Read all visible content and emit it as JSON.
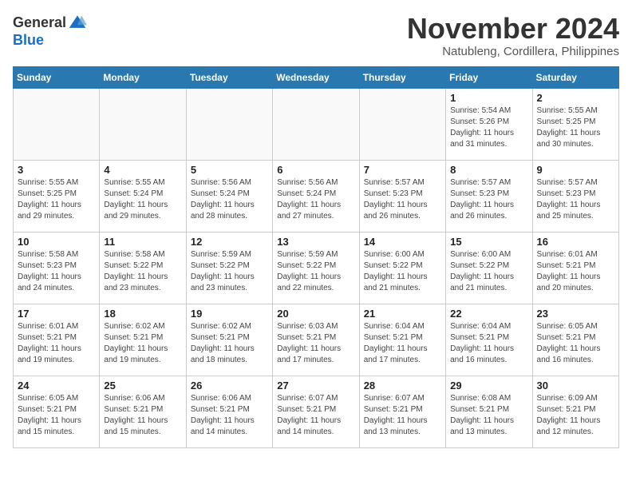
{
  "header": {
    "logo_general": "General",
    "logo_blue": "Blue",
    "month": "November 2024",
    "location": "Natubleng, Cordillera, Philippines"
  },
  "weekdays": [
    "Sunday",
    "Monday",
    "Tuesday",
    "Wednesday",
    "Thursday",
    "Friday",
    "Saturday"
  ],
  "weeks": [
    [
      {
        "day": "",
        "info": ""
      },
      {
        "day": "",
        "info": ""
      },
      {
        "day": "",
        "info": ""
      },
      {
        "day": "",
        "info": ""
      },
      {
        "day": "",
        "info": ""
      },
      {
        "day": "1",
        "info": "Sunrise: 5:54 AM\nSunset: 5:26 PM\nDaylight: 11 hours and 31 minutes."
      },
      {
        "day": "2",
        "info": "Sunrise: 5:55 AM\nSunset: 5:25 PM\nDaylight: 11 hours and 30 minutes."
      }
    ],
    [
      {
        "day": "3",
        "info": "Sunrise: 5:55 AM\nSunset: 5:25 PM\nDaylight: 11 hours and 29 minutes."
      },
      {
        "day": "4",
        "info": "Sunrise: 5:55 AM\nSunset: 5:24 PM\nDaylight: 11 hours and 29 minutes."
      },
      {
        "day": "5",
        "info": "Sunrise: 5:56 AM\nSunset: 5:24 PM\nDaylight: 11 hours and 28 minutes."
      },
      {
        "day": "6",
        "info": "Sunrise: 5:56 AM\nSunset: 5:24 PM\nDaylight: 11 hours and 27 minutes."
      },
      {
        "day": "7",
        "info": "Sunrise: 5:57 AM\nSunset: 5:23 PM\nDaylight: 11 hours and 26 minutes."
      },
      {
        "day": "8",
        "info": "Sunrise: 5:57 AM\nSunset: 5:23 PM\nDaylight: 11 hours and 26 minutes."
      },
      {
        "day": "9",
        "info": "Sunrise: 5:57 AM\nSunset: 5:23 PM\nDaylight: 11 hours and 25 minutes."
      }
    ],
    [
      {
        "day": "10",
        "info": "Sunrise: 5:58 AM\nSunset: 5:23 PM\nDaylight: 11 hours and 24 minutes."
      },
      {
        "day": "11",
        "info": "Sunrise: 5:58 AM\nSunset: 5:22 PM\nDaylight: 11 hours and 23 minutes."
      },
      {
        "day": "12",
        "info": "Sunrise: 5:59 AM\nSunset: 5:22 PM\nDaylight: 11 hours and 23 minutes."
      },
      {
        "day": "13",
        "info": "Sunrise: 5:59 AM\nSunset: 5:22 PM\nDaylight: 11 hours and 22 minutes."
      },
      {
        "day": "14",
        "info": "Sunrise: 6:00 AM\nSunset: 5:22 PM\nDaylight: 11 hours and 21 minutes."
      },
      {
        "day": "15",
        "info": "Sunrise: 6:00 AM\nSunset: 5:22 PM\nDaylight: 11 hours and 21 minutes."
      },
      {
        "day": "16",
        "info": "Sunrise: 6:01 AM\nSunset: 5:21 PM\nDaylight: 11 hours and 20 minutes."
      }
    ],
    [
      {
        "day": "17",
        "info": "Sunrise: 6:01 AM\nSunset: 5:21 PM\nDaylight: 11 hours and 19 minutes."
      },
      {
        "day": "18",
        "info": "Sunrise: 6:02 AM\nSunset: 5:21 PM\nDaylight: 11 hours and 19 minutes."
      },
      {
        "day": "19",
        "info": "Sunrise: 6:02 AM\nSunset: 5:21 PM\nDaylight: 11 hours and 18 minutes."
      },
      {
        "day": "20",
        "info": "Sunrise: 6:03 AM\nSunset: 5:21 PM\nDaylight: 11 hours and 17 minutes."
      },
      {
        "day": "21",
        "info": "Sunrise: 6:04 AM\nSunset: 5:21 PM\nDaylight: 11 hours and 17 minutes."
      },
      {
        "day": "22",
        "info": "Sunrise: 6:04 AM\nSunset: 5:21 PM\nDaylight: 11 hours and 16 minutes."
      },
      {
        "day": "23",
        "info": "Sunrise: 6:05 AM\nSunset: 5:21 PM\nDaylight: 11 hours and 16 minutes."
      }
    ],
    [
      {
        "day": "24",
        "info": "Sunrise: 6:05 AM\nSunset: 5:21 PM\nDaylight: 11 hours and 15 minutes."
      },
      {
        "day": "25",
        "info": "Sunrise: 6:06 AM\nSunset: 5:21 PM\nDaylight: 11 hours and 15 minutes."
      },
      {
        "day": "26",
        "info": "Sunrise: 6:06 AM\nSunset: 5:21 PM\nDaylight: 11 hours and 14 minutes."
      },
      {
        "day": "27",
        "info": "Sunrise: 6:07 AM\nSunset: 5:21 PM\nDaylight: 11 hours and 14 minutes."
      },
      {
        "day": "28",
        "info": "Sunrise: 6:07 AM\nSunset: 5:21 PM\nDaylight: 11 hours and 13 minutes."
      },
      {
        "day": "29",
        "info": "Sunrise: 6:08 AM\nSunset: 5:21 PM\nDaylight: 11 hours and 13 minutes."
      },
      {
        "day": "30",
        "info": "Sunrise: 6:09 AM\nSunset: 5:21 PM\nDaylight: 11 hours and 12 minutes."
      }
    ]
  ]
}
